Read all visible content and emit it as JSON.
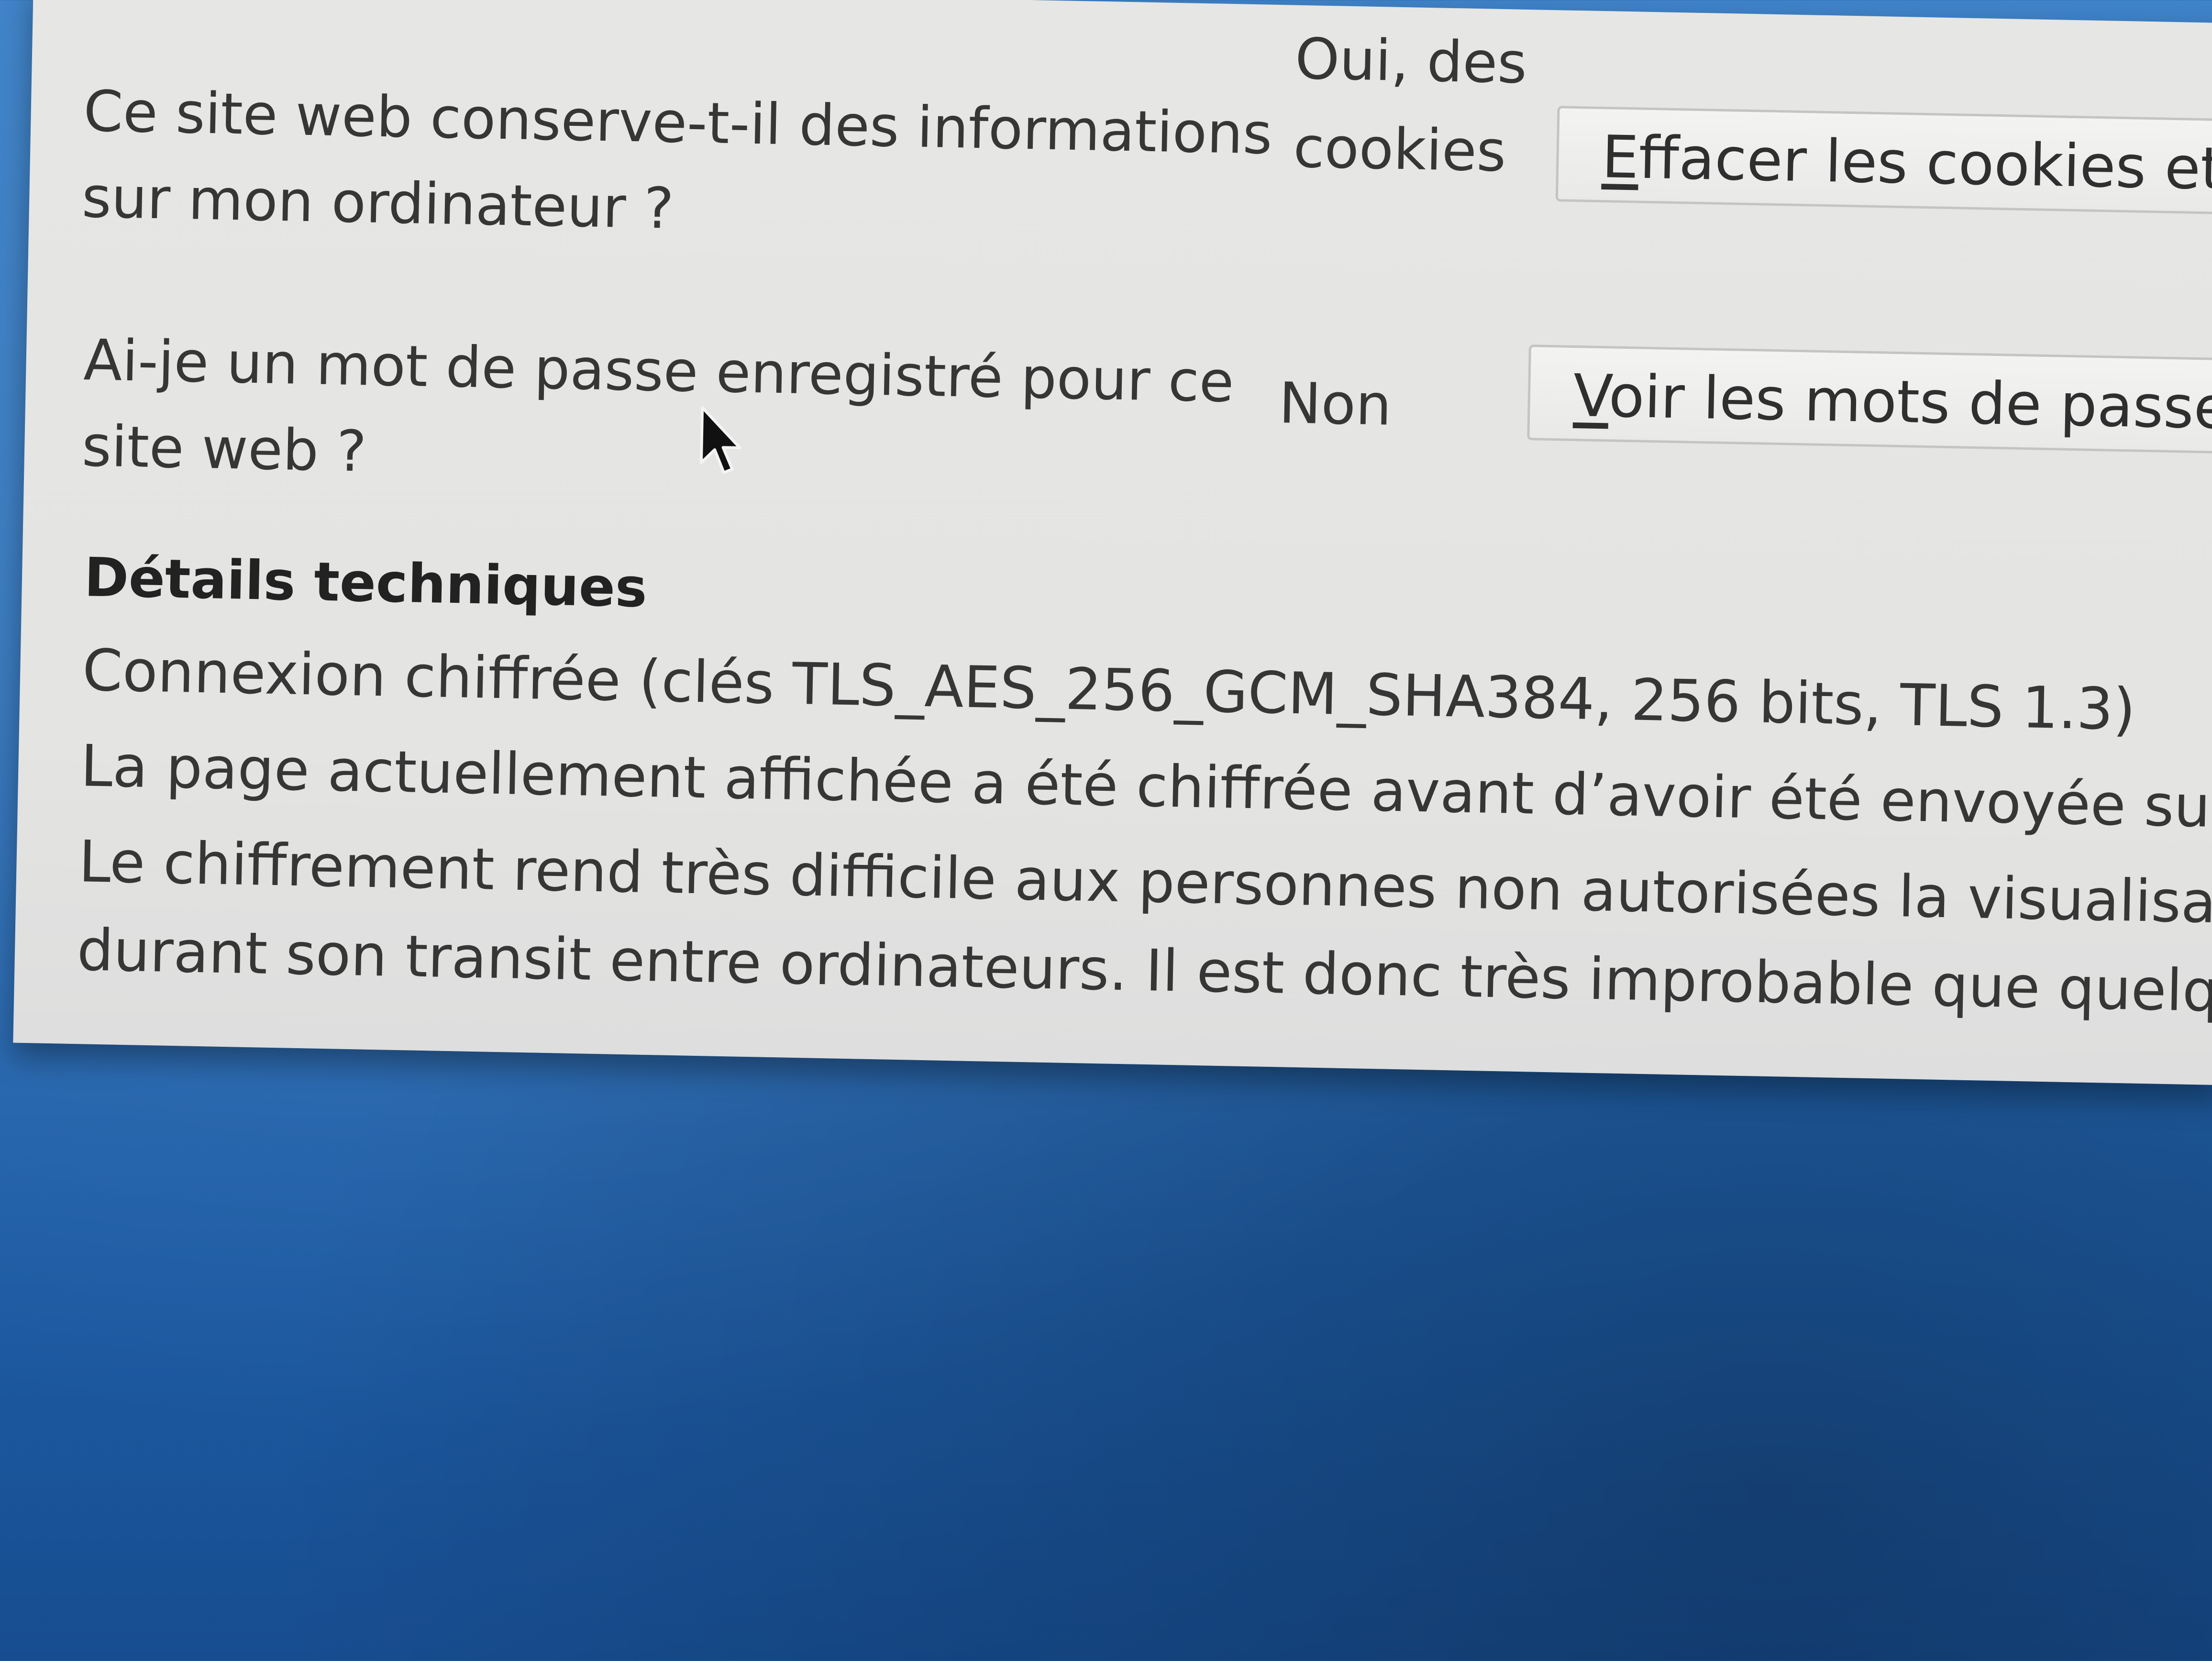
{
  "rows": [
    {
      "question": "Ce site web conserve-t-il des informations sur mon ordinateur ?",
      "answer": "Oui, des cookies",
      "button_mnemonic": "E",
      "button_rest": "ffacer les cookies et"
    },
    {
      "question": "Ai-je un mot de passe enregistré pour ce site web ?",
      "answer": "Non",
      "button_mnemonic": "V",
      "button_rest": "oir les mots de passe"
    }
  ],
  "technical": {
    "title": "Détails techniques",
    "connection": "Connexion chiffrée (clés TLS_AES_256_GCM_SHA384, 256 bits, TLS 1.3)",
    "line1": "La page actuellement affichée a été chiffrée avant d’avoir été envoyée sur Inter",
    "line2": "Le chiffrement rend très difficile aux personnes non autorisées la visualisation",
    "line3": "durant son transit entre ordinateurs. Il est donc très improbable que quelqu’un"
  },
  "icons": {
    "cursor": "mouse-pointer-icon"
  }
}
